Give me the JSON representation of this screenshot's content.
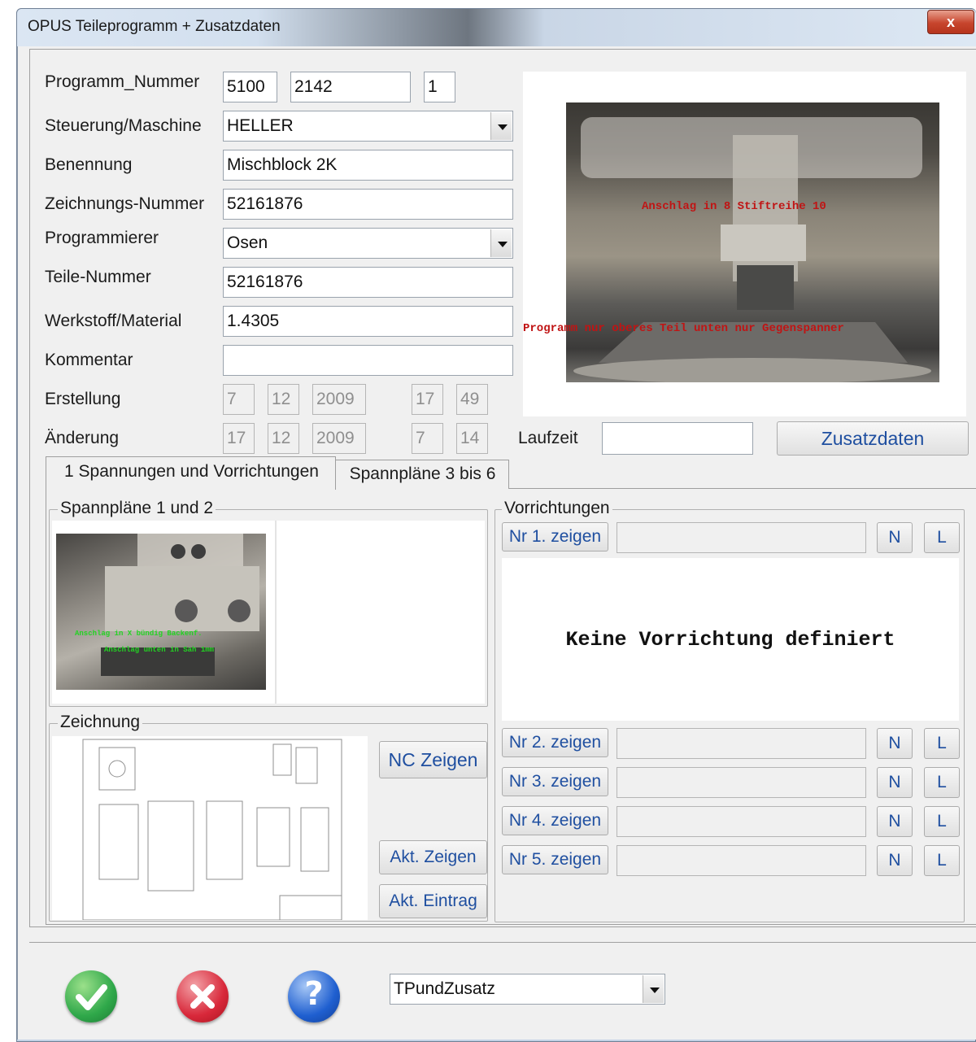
{
  "window": {
    "title": "OPUS Teileprogramm + Zusatzdaten",
    "close_glyph": "x"
  },
  "form": {
    "program_number": {
      "label": "Programm_Nummer",
      "part1": "5100",
      "part2": "2142",
      "part3": "1"
    },
    "steuerung": {
      "label": "Steuerung/Maschine",
      "value": "HELLER"
    },
    "benennung": {
      "label": "Benennung",
      "value": "Mischblock 2K"
    },
    "zeichnungs_nummer": {
      "label": "Zeichnungs-Nummer",
      "value": "52161876"
    },
    "programmierer": {
      "label": "Programmierer",
      "value": "Osen"
    },
    "teile_nummer": {
      "label": "Teile-Nummer",
      "value": "52161876"
    },
    "werkstoff": {
      "label": "Werkstoff/Material",
      "value": "1.4305"
    },
    "kommentar": {
      "label": "Kommentar",
      "value": ""
    },
    "erstellung": {
      "label": "Erstellung",
      "day": "7",
      "month": "12",
      "year": "2009",
      "hour": "17",
      "minute": "49"
    },
    "aenderung": {
      "label": "Änderung",
      "day": "17",
      "month": "12",
      "year": "2009",
      "hour": "7",
      "minute": "14"
    },
    "laufzeit": {
      "label": "Laufzeit",
      "value": ""
    },
    "zusatzdaten_button": "Zusatzdaten"
  },
  "photo": {
    "overlay_line1": "Anschlag in 8 Stiftreihe 10",
    "overlay_line2": "Programm nur oberes Teil unten nur Gegenspanner"
  },
  "tabs": [
    {
      "label": "1 Spannungen und Vorrichtungen",
      "active": true
    },
    {
      "label": "Spannpläne 3 bis 6",
      "active": false
    }
  ],
  "spannplaene": {
    "title": "Spannpläne 1 und 2",
    "photo_text1": "Anschlag in X bündig Backenf.",
    "photo_text2": "Anschlag unten in Sah 1mm"
  },
  "zeichnung": {
    "title": "Zeichnung",
    "nc_button": "NC Zeigen",
    "akt_zeigen_button": "Akt. Zeigen",
    "akt_eintrag_button": "Akt. Eintrag"
  },
  "vorrichtungen": {
    "title": "Vorrichtungen",
    "empty_text": "Keine Vorrichtung definiert",
    "rows": [
      {
        "label": "Nr 1. zeigen",
        "value": "",
        "n": "N",
        "l": "L"
      },
      {
        "label": "Nr 2. zeigen",
        "value": "",
        "n": "N",
        "l": "L"
      },
      {
        "label": "Nr 3. zeigen",
        "value": "",
        "n": "N",
        "l": "L"
      },
      {
        "label": "Nr 4. zeigen",
        "value": "",
        "n": "N",
        "l": "L"
      },
      {
        "label": "Nr 5. zeigen",
        "value": "",
        "n": "N",
        "l": "L"
      }
    ]
  },
  "bottom": {
    "ok_icon": "check-icon",
    "cancel_icon": "cancel-icon",
    "help_icon": "help-icon",
    "help_glyph": "?",
    "view_select": "TPundZusatz"
  },
  "colors": {
    "accent_blue": "#1f4fa0",
    "ok_green": "#2fa84a",
    "cancel_red": "#d8283a",
    "help_blue": "#1f5fd0",
    "overlay_red": "#c01414",
    "overlay_green": "#22d422"
  }
}
